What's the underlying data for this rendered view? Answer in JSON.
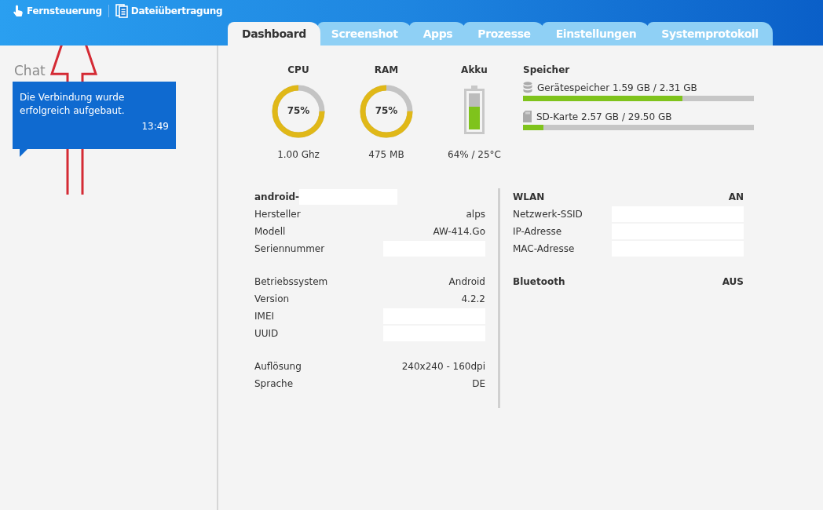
{
  "toolbar": [
    {
      "kind": "remote",
      "label": "Fernsteuerung"
    },
    {
      "kind": "transfer",
      "label": "Dateiübertragung"
    }
  ],
  "tabs": [
    {
      "label": "Dashboard",
      "selected": true
    },
    {
      "label": "Screenshot",
      "selected": false
    },
    {
      "label": "Apps",
      "selected": false
    },
    {
      "label": "Prozesse",
      "selected": false
    },
    {
      "label": "Einstellungen",
      "selected": false
    },
    {
      "label": "Systemprotokoll",
      "selected": false
    }
  ],
  "chat": {
    "title": "Chat",
    "messages": [
      {
        "text": "Die Verbindung wurde erfolgreich aufgebaut.",
        "time": "13:49"
      }
    ]
  },
  "gauges": [
    {
      "title": "CPU",
      "value": "75%",
      "level": 0.75,
      "caption": "1.00 Ghz"
    },
    {
      "title": "RAM",
      "value": "75%",
      "level": 0.75,
      "caption": "475 MB"
    }
  ],
  "battery": {
    "title": "Akku",
    "level": 0.64,
    "caption": "64% / 25°C"
  },
  "storage": {
    "title": "Speicher",
    "items": [
      {
        "kind": "internal",
        "label": "Gerätespeicher 1.59 GB / 2.31 GB",
        "level": 0.69
      },
      {
        "kind": "sd",
        "label": "SD-Karte 2.57 GB / 29.50 GB",
        "level": 0.087
      }
    ]
  },
  "device": {
    "name": "android-",
    "groups": [
      [
        {
          "label": "Hersteller",
          "value": "alps"
        },
        {
          "label": "Modell",
          "value": "AW-414.Go"
        },
        {
          "label": "Seriennummer"
        }
      ],
      [
        {
          "label": "Betriebssystem",
          "value": "Android"
        },
        {
          "label": "Version",
          "value": "4.2.2"
        },
        {
          "label": "IMEI"
        },
        {
          "label": "UUID"
        }
      ],
      [
        {
          "label": "Auflösung",
          "value": "240x240 - 160dpi"
        },
        {
          "label": "Sprache",
          "value": "DE"
        }
      ]
    ]
  },
  "network": [
    {
      "title": "WLAN",
      "state": "AN",
      "rows": [
        {
          "label": "Netzwerk-SSID"
        },
        {
          "label": "IP-Adresse"
        },
        {
          "label": "MAC-Adresse"
        }
      ]
    },
    {
      "title": "Bluetooth",
      "state": "AUS"
    }
  ]
}
